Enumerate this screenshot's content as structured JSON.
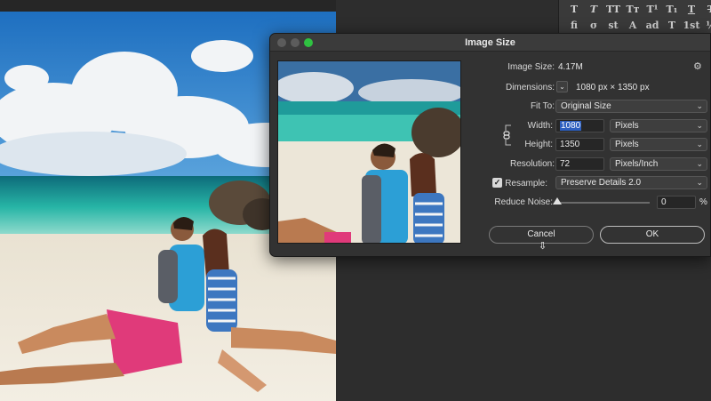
{
  "type_panel": {
    "row1": [
      "T",
      "T",
      "TT",
      "Tт",
      "T¹",
      "T₁",
      "T",
      "T"
    ],
    "row2": [
      "fi",
      "σ",
      "st",
      "A",
      "ad",
      "T",
      "1st",
      "½"
    ]
  },
  "dialog": {
    "title": "Image Size",
    "image_size_label": "Image Size:",
    "image_size_value": "4.17M",
    "dimensions_label": "Dimensions:",
    "dimensions_value": "1080 px  ×  1350 px",
    "fit_to_label": "Fit To:",
    "fit_to_value": "Original Size",
    "width_label": "Width:",
    "width_value": "1080",
    "width_unit": "Pixels",
    "height_label": "Height:",
    "height_value": "1350",
    "height_unit": "Pixels",
    "resolution_label": "Resolution:",
    "resolution_value": "72",
    "resolution_unit": "Pixels/Inch",
    "resample_label": "Resample:",
    "resample_checked": true,
    "resample_value": "Preserve Details 2.0",
    "reduce_noise_label": "Reduce Noise:",
    "reduce_noise_value": "0",
    "reduce_noise_unit": "%",
    "reduce_noise_level": 0,
    "cancel_label": "Cancel",
    "ok_label": "OK"
  },
  "colors": {
    "accent": "#2d5fbf",
    "traffic_green": "#2fc241",
    "dialog_bg": "#323232"
  }
}
